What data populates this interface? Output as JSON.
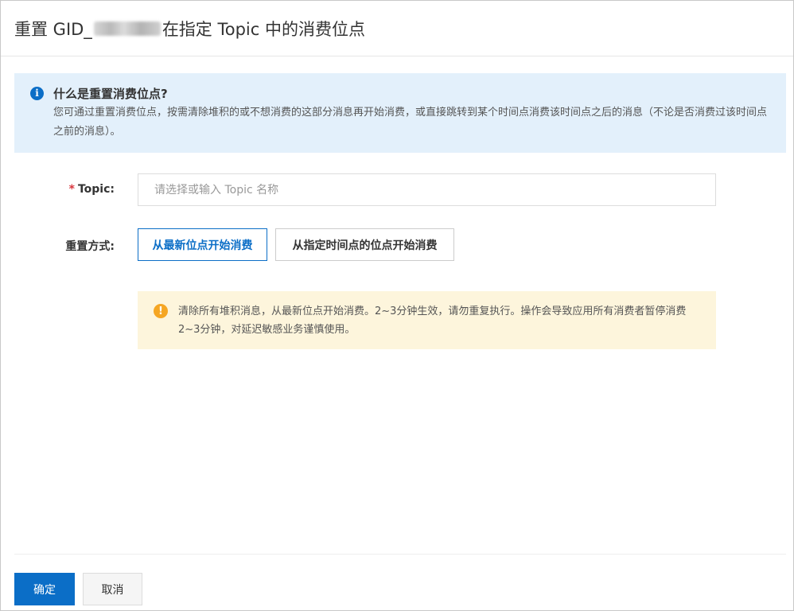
{
  "dialog": {
    "title_prefix": "重置 GID_",
    "title_suffix": "在指定 Topic 中的消费位点"
  },
  "info": {
    "icon": "info-circle-icon",
    "title": "什么是重置消费位点?",
    "description": "您可通过重置消费位点，按需清除堆积的或不想消费的这部分消息再开始消费，或直接跳转到某个时间点消费该时间点之后的消息（不论是否消费过该时间点之前的消息）。"
  },
  "form": {
    "topic": {
      "required_mark": "*",
      "label": "Topic:",
      "placeholder": "请选择或输入 Topic 名称",
      "value": ""
    },
    "reset_method": {
      "label": "重置方式:",
      "options": [
        {
          "label": "从最新位点开始消费",
          "selected": true
        },
        {
          "label": "从指定时间点的位点开始消费",
          "selected": false
        }
      ]
    },
    "warning": {
      "icon": "warning-circle-icon",
      "text": "清除所有堆积消息，从最新位点开始消费。2~3分钟生效，请勿重复执行。操作会导致应用所有消费者暂停消费2~3分钟，对延迟敏感业务谨慎使用。"
    }
  },
  "footer": {
    "confirm_label": "确定",
    "cancel_label": "取消"
  },
  "colors": {
    "primary": "#0b6ec7",
    "info_bg": "#e3f0fb",
    "warning_bg": "#fdf5dc",
    "warning_icon": "#f5a623",
    "required": "#d9363e"
  }
}
